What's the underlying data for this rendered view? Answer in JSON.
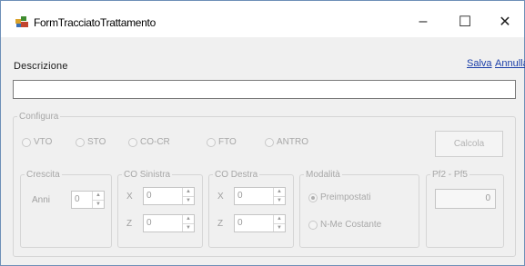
{
  "window": {
    "title": "FormTracciatoTrattamento",
    "controls": {
      "minimize": "–",
      "maximize": "☐",
      "close": "✕"
    }
  },
  "header": {
    "description_label": "Descrizione",
    "salva_label": "Salva",
    "annulla_label": "Annulla",
    "description_value": ""
  },
  "configura": {
    "legend": "Configura",
    "radios": [
      {
        "label": "VTO",
        "checked": false
      },
      {
        "label": "STO",
        "checked": false
      },
      {
        "label": "CO-CR",
        "checked": false
      },
      {
        "label": "FTO",
        "checked": false
      },
      {
        "label": "ANTRO",
        "checked": false
      }
    ],
    "calcola_label": "Calcola"
  },
  "crescita": {
    "legend": "Crescita",
    "anni_label": "Anni",
    "anni_value": "0"
  },
  "co_sinistra": {
    "legend": "CO Sinistra",
    "x_label": "X",
    "x_value": "0",
    "z_label": "Z",
    "z_value": "0"
  },
  "co_destra": {
    "legend": "CO Destra",
    "x_label": "X",
    "x_value": "0",
    "z_label": "Z",
    "z_value": "0"
  },
  "modalita": {
    "legend": "Modalità",
    "options": [
      {
        "label": "Preimpostati",
        "checked": true
      },
      {
        "label": "N-Me Costante",
        "checked": false
      }
    ]
  },
  "pf": {
    "legend": "Pf2 - Pf5",
    "value": "0"
  },
  "icons": {
    "app": "app-logo-icon",
    "spin_up": "▲",
    "spin_down": "▼"
  },
  "colors": {
    "link": "#1a3ea8",
    "disabled_text": "#a0a0a0"
  }
}
